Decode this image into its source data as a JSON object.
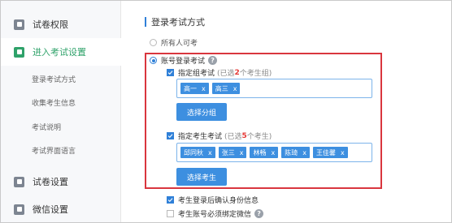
{
  "sidebar": {
    "items": [
      {
        "label": "试卷权限",
        "icon": "shield-icon"
      },
      {
        "label": "进入考试设置",
        "icon": "enter-settings-icon"
      },
      {
        "label": "试卷设置",
        "icon": "paper-settings-icon"
      },
      {
        "label": "微信设置",
        "icon": "wechat-icon"
      }
    ],
    "sub_items": [
      "登录考试方式",
      "收集考生信息",
      "考试说明",
      "考试界面语言"
    ]
  },
  "main": {
    "section_title": "登录考试方式",
    "option_all": "所有人可考",
    "option_account": "账号登录考试",
    "group_option": {
      "label": "指定组考试",
      "note_prefix": "(已选",
      "count": "2",
      "note_suffix": "个考生组)",
      "tags": [
        "高一",
        "高三"
      ],
      "button": "选择分组"
    },
    "examinee_option": {
      "label": "指定考生考试",
      "note_prefix": "(已选",
      "count": "5",
      "note_suffix": "个考生)",
      "tags": [
        "邱同秋",
        "张三",
        "林畅",
        "陈琦",
        "王佳馨"
      ],
      "button": "选择考生"
    },
    "confirm_identity": "考生登录后确认身份信息",
    "bind_wechat": "考生账号必须绑定微信",
    "tag_close": "x",
    "help_glyph": "?"
  },
  "colors": {
    "accent_green": "#2fa26a",
    "accent_blue": "#3d8fe0",
    "highlight_red": "#d9363e"
  }
}
